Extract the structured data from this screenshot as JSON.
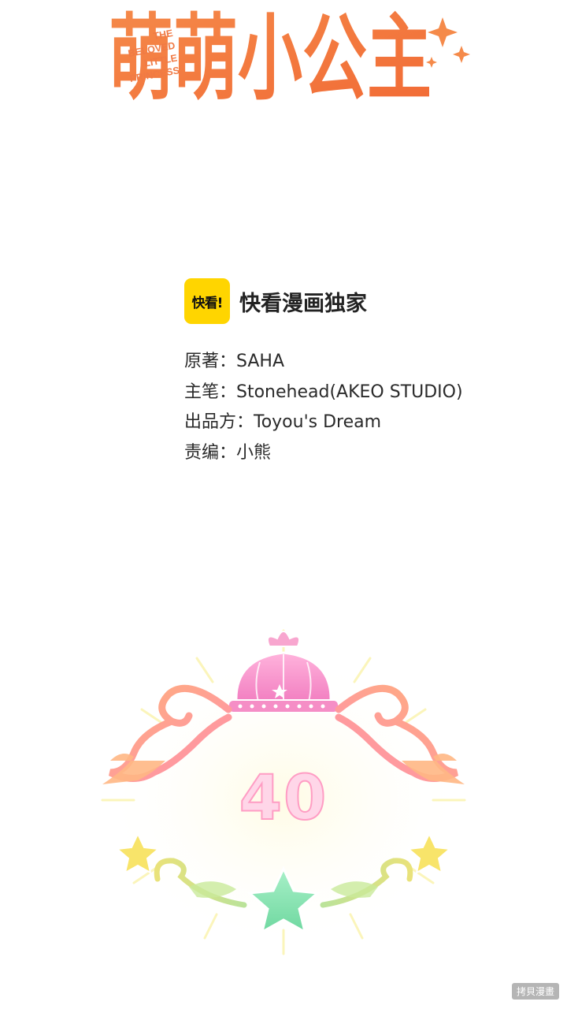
{
  "header": {
    "title_zh": "萌萌小公主",
    "title_en_lines": [
      "THE",
      "BELOVED",
      "LITTLE",
      "PRINCESS"
    ],
    "title_color": "#f4733c"
  },
  "publisher": {
    "logo_text": "快看!",
    "logo_color": "#ffd500",
    "label": "快看漫画独家"
  },
  "credits": [
    {
      "text": "原著：SAHA"
    },
    {
      "text": "主笔：Stonehead(AKEO STUDIO)"
    },
    {
      "text": "出品方：Toyou's Dream"
    },
    {
      "text": "责编：小熊"
    }
  ],
  "chapter": {
    "number": "40",
    "icons": [
      "crown-icon",
      "star-icon",
      "scroll-ornament-icon"
    ]
  },
  "watermark": {
    "text": "拷貝漫畫"
  }
}
